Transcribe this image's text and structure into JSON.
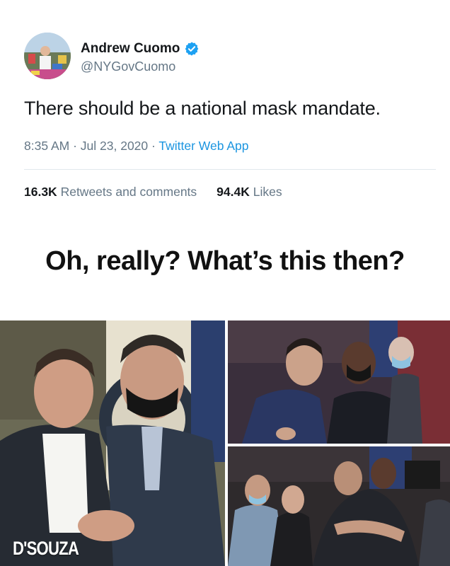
{
  "tweet": {
    "author_name": "Andrew Cuomo",
    "handle": "@NYGovCuomo",
    "verified_icon": "verified-badge-icon",
    "text": "There should be a national mask mandate.",
    "time": "8:35 AM",
    "separator": "·",
    "date": "Jul 23, 2020",
    "source": "Twitter Web App",
    "retweets_count": "16.3K",
    "retweets_label": "Retweets and comments",
    "likes_count": "94.4K",
    "likes_label": "Likes"
  },
  "headline": "Oh, really? What’s this then?",
  "photos": {
    "watermark": "D'SOUZA"
  },
  "colors": {
    "text": "#14171a",
    "secondary": "#657786",
    "link": "#1b95e0",
    "verified": "#1da1f2"
  }
}
